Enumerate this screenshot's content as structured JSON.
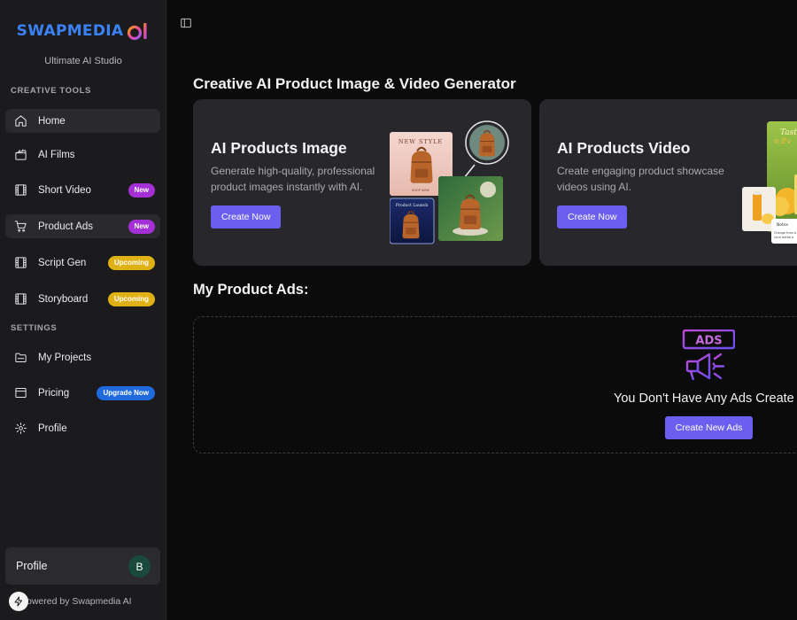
{
  "brand": {
    "name": "SWAPMEDIA",
    "ai_mark": "ai",
    "tagline": "Ultimate AI Studio",
    "color": "#3b82f6"
  },
  "sidebar": {
    "creative_title": "CREATIVE TOOLS",
    "settings_title": "SETTINGS",
    "items": [
      {
        "label": "Home",
        "icon": "home-icon"
      },
      {
        "label": "AI Films",
        "icon": "clapperboard-icon"
      },
      {
        "label": "Short Video",
        "icon": "film-icon",
        "badge": "New"
      },
      {
        "label": "Product Ads",
        "icon": "cart-icon",
        "badge": "New"
      },
      {
        "label": "Script Gen",
        "icon": "film-icon",
        "badge": "Upcoming"
      },
      {
        "label": "Storyboard",
        "icon": "film-icon",
        "badge": "Upcoming"
      },
      {
        "label": "My Projects",
        "icon": "folder-icon"
      },
      {
        "label": "Pricing",
        "icon": "card-icon",
        "badge": "Upgrade Now"
      },
      {
        "label": "Profile",
        "icon": "gear-icon"
      }
    ],
    "profile": {
      "label": "Profile",
      "avatar_initial": "B"
    },
    "powered_by": "owered by Swapmedia AI"
  },
  "main": {
    "title": "Creative AI Product Image & Video Generator",
    "cards": [
      {
        "title": "AI Products Image",
        "description": "Generate high-quality, professional product images instantly with AI.",
        "button": "Create Now",
        "thumb_labels": [
          "NEW STYLE",
          "SHOP NOW",
          "Product Launch"
        ]
      },
      {
        "title": "AI Products Video",
        "description": "Create engaging product showcase videos using AI.",
        "button": "Create Now",
        "thumb_labels": [
          "Tast",
          "n Ev",
          "Notes",
          "Change from a",
          "juice bottle a"
        ]
      }
    ],
    "my_ads_title": "My Product Ads:",
    "empty": {
      "badge": "ADS",
      "message": "You Don't Have Any Ads Create",
      "button": "Create New Ads"
    }
  },
  "colors": {
    "accent_button": "#6b5ff0",
    "badge_new": "#a52fd6",
    "badge_upcoming": "#e0b114",
    "badge_upgrade": "#1f6bdd"
  }
}
